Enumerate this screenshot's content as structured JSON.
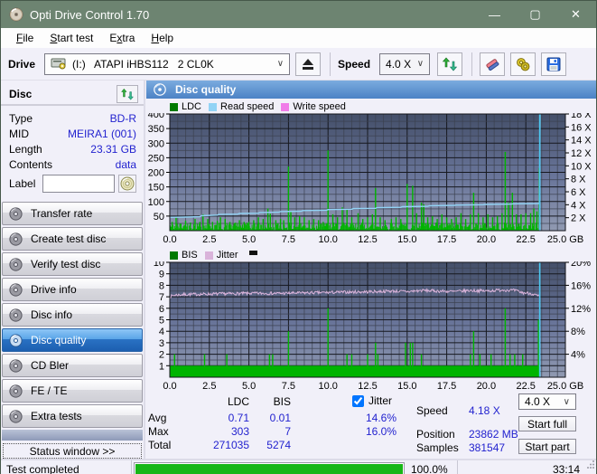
{
  "window": {
    "title": "Opti Drive Control 1.70",
    "controls": {
      "minimize": "—",
      "maximize": "▢",
      "close": "✕"
    }
  },
  "menu": {
    "items": [
      {
        "label": "File",
        "accel": 0
      },
      {
        "label": "Start test",
        "accel": 0
      },
      {
        "label": "Extra",
        "accel": 1
      },
      {
        "label": "Help",
        "accel": 0
      }
    ]
  },
  "toolbar": {
    "drive_label": "Drive",
    "drive_value": "(I:)   ATAPI iHBS112   2 CL0K",
    "speed_label": "Speed",
    "speed_value": "4.0 X"
  },
  "sidebar": {
    "disc_header": "Disc",
    "info": [
      {
        "label": "Type",
        "value": "BD-R"
      },
      {
        "label": "MID",
        "value": "MEIRA1 (001)"
      },
      {
        "label": "Length",
        "value": "23.31 GB"
      },
      {
        "label": "Contents",
        "value": "data"
      }
    ],
    "label_field": {
      "label": "Label",
      "value": ""
    },
    "buttons": [
      {
        "label": "Transfer rate"
      },
      {
        "label": "Create test disc"
      },
      {
        "label": "Verify test disc"
      },
      {
        "label": "Drive info"
      },
      {
        "label": "Disc info"
      },
      {
        "label": "Disc quality",
        "active": true
      },
      {
        "label": "CD Bler"
      },
      {
        "label": "FE / TE"
      },
      {
        "label": "Extra tests"
      }
    ],
    "status_window": "Status window >>"
  },
  "panel": {
    "title": "Disc quality"
  },
  "results": {
    "col_ldc": "LDC",
    "col_bis": "BIS",
    "jitter_label": "Jitter",
    "jitter_checked": true,
    "rows": {
      "avg_label": "Avg",
      "avg_ldc": "0.71",
      "avg_bis": "0.01",
      "avg_jitter": "14.6%",
      "max_label": "Max",
      "max_ldc": "303",
      "max_bis": "7",
      "max_jitter": "16.0%",
      "total_label": "Total",
      "total_ldc": "271035",
      "total_bis": "5274"
    },
    "speed_label": "Speed",
    "speed_value": "4.18 X",
    "position_label": "Position",
    "position_value": "23862 MB",
    "samples_label": "Samples",
    "samples_value": "381547",
    "speed_select": "4.0 X",
    "start_full": "Start full",
    "start_part": "Start part"
  },
  "statusbar": {
    "text": "Test completed",
    "progress": "100.0%",
    "progress_value": 100,
    "time": "33:14"
  },
  "colors": {
    "accent_blue": "#2222cf",
    "ldc_green": "#00b400",
    "read_blue": "#92d3f5",
    "write_pink": "#f07ce8",
    "jitter_pink": "#d9b3da",
    "cursor_cyan": "#4cc8f0",
    "progress_green": "#17b617",
    "titlebar_green": "#6d8471"
  },
  "chart_data": [
    {
      "type": "spikes+line",
      "title": "Disc quality (LDC / Read speed)",
      "xmax": 25,
      "data_end": 23.38,
      "x_tick_step": 2.5,
      "x_unit": "GB",
      "left_axis": {
        "max": 400,
        "ticks": [
          400,
          350,
          300,
          250,
          200,
          150,
          100,
          50
        ]
      },
      "right_axis": {
        "max": 18,
        "ticks": [
          18,
          16,
          14,
          12,
          10,
          8,
          6,
          4,
          2
        ],
        "suffix": " X"
      },
      "grid": {
        "minor_x": 0.5,
        "major_x": 2.5,
        "minor_y": 25,
        "major_y": 50
      },
      "cursor": {
        "x": 23.38,
        "color": "#4cc8f0"
      },
      "series": [
        {
          "name": "LDC",
          "type": "spikes",
          "color": "#00b400",
          "legend_color": "#007a00",
          "scale": "left",
          "baseline_noise": {
            "max": 26,
            "step": 0.055,
            "seed": 42
          },
          "spikes": [
            [
              0.15,
              30
            ],
            [
              0.4,
              46
            ],
            [
              0.7,
              24
            ],
            [
              1.0,
              34
            ],
            [
              1.3,
              28
            ],
            [
              1.6,
              40
            ],
            [
              1.9,
              30
            ],
            [
              2.1,
              56
            ],
            [
              2.4,
              40
            ],
            [
              2.7,
              30
            ],
            [
              3.0,
              34
            ],
            [
              3.2,
              46
            ],
            [
              3.5,
              40
            ],
            [
              3.8,
              30
            ],
            [
              4.1,
              26
            ],
            [
              4.4,
              36
            ],
            [
              4.7,
              30
            ],
            [
              5.0,
              30
            ],
            [
              5.3,
              36
            ],
            [
              5.6,
              46
            ],
            [
              5.9,
              40
            ],
            [
              6.2,
              76
            ],
            [
              6.35,
              58
            ],
            [
              6.7,
              36
            ],
            [
              7.0,
              40
            ],
            [
              7.2,
              36
            ],
            [
              7.5,
              220
            ],
            [
              7.65,
              66
            ],
            [
              7.9,
              46
            ],
            [
              8.2,
              50
            ],
            [
              8.5,
              46
            ],
            [
              8.8,
              36
            ],
            [
              9.1,
              40
            ],
            [
              9.4,
              36
            ],
            [
              9.7,
              30
            ],
            [
              10.0,
              275
            ],
            [
              10.3,
              56
            ],
            [
              10.6,
              46
            ],
            [
              10.9,
              80
            ],
            [
              11.2,
              74
            ],
            [
              11.5,
              46
            ],
            [
              11.9,
              60
            ],
            [
              12.2,
              40
            ],
            [
              12.5,
              46
            ],
            [
              12.8,
              56
            ],
            [
              13.0,
              146
            ],
            [
              13.3,
              46
            ],
            [
              13.6,
              36
            ],
            [
              14.0,
              40
            ],
            [
              14.3,
              46
            ],
            [
              14.6,
              40
            ],
            [
              15.0,
              160
            ],
            [
              15.35,
              154
            ],
            [
              15.6,
              60
            ],
            [
              15.9,
              96
            ],
            [
              16.05,
              90
            ],
            [
              16.3,
              46
            ],
            [
              16.6,
              50
            ],
            [
              16.9,
              40
            ],
            [
              17.2,
              56
            ],
            [
              17.5,
              46
            ],
            [
              17.8,
              40
            ],
            [
              18.1,
              46
            ],
            [
              18.4,
              60
            ],
            [
              18.7,
              40
            ],
            [
              19.0,
              56
            ],
            [
              19.2,
              130
            ],
            [
              19.5,
              60
            ],
            [
              19.8,
              46
            ],
            [
              20.1,
              56
            ],
            [
              20.4,
              46
            ],
            [
              20.7,
              50
            ],
            [
              21.0,
              60
            ],
            [
              21.2,
              270
            ],
            [
              21.4,
              96
            ],
            [
              21.65,
              130
            ],
            [
              21.9,
              56
            ],
            [
              22.2,
              56
            ],
            [
              22.5,
              60
            ],
            [
              22.8,
              60
            ],
            [
              23.0,
              76
            ],
            [
              23.2,
              66
            ],
            [
              23.35,
              215
            ]
          ]
        },
        {
          "name": "Read speed",
          "type": "line",
          "color": "#92d3f5",
          "scale": "right",
          "points": [
            [
              0,
              2.05
            ],
            [
              1,
              2.1
            ],
            [
              1.9,
              2.15
            ],
            [
              2.0,
              2.3
            ],
            [
              3.0,
              2.4
            ],
            [
              3.1,
              2.5
            ],
            [
              4.3,
              2.55
            ],
            [
              4.4,
              2.65
            ],
            [
              5.6,
              2.7
            ],
            [
              5.7,
              2.8
            ],
            [
              6.9,
              2.85
            ],
            [
              7.0,
              2.95
            ],
            [
              8.3,
              3.0
            ],
            [
              8.4,
              3.1
            ],
            [
              9.9,
              3.15
            ],
            [
              10.0,
              3.25
            ],
            [
              11.5,
              3.3
            ],
            [
              11.6,
              3.4
            ],
            [
              13.0,
              3.45
            ],
            [
              13.1,
              3.55
            ],
            [
              14.6,
              3.6
            ],
            [
              14.7,
              3.7
            ],
            [
              16.3,
              3.75
            ],
            [
              16.4,
              3.85
            ],
            [
              18.0,
              3.9
            ],
            [
              18.1,
              3.95
            ],
            [
              19.8,
              4.0
            ],
            [
              19.9,
              4.05
            ],
            [
              21.6,
              4.1
            ],
            [
              21.7,
              4.15
            ],
            [
              23.3,
              4.18
            ],
            [
              23.36,
              4.2
            ],
            [
              23.4,
              18
            ]
          ]
        },
        {
          "name": "Write speed",
          "type": "line",
          "color": "#f07ce8",
          "scale": "right",
          "points": []
        }
      ]
    },
    {
      "type": "spikes+line",
      "title": "Disc quality (BIS / Jitter)",
      "xmax": 25,
      "data_end": 23.38,
      "x_tick_step": 2.5,
      "x_unit": "GB",
      "left_axis": {
        "max": 10,
        "ticks": [
          10,
          9,
          8,
          7,
          6,
          5,
          4,
          3,
          2,
          1
        ]
      },
      "right_axis": {
        "max": 20,
        "ticks": [
          20,
          16,
          12,
          8,
          4
        ],
        "suffix": "%"
      },
      "grid": {
        "minor_x": 0.5,
        "major_x": 2.5,
        "minor_y": 0.5,
        "major_y": 1
      },
      "cursor": {
        "x": 23.38,
        "color": "#4cc8f0"
      },
      "series": [
        {
          "name": "BIS",
          "type": "spikes",
          "color": "#00b400",
          "legend_color": "#007a00",
          "scale": "left",
          "band": 1,
          "spikes": [
            [
              0.3,
              2
            ],
            [
              2.2,
              2
            ],
            [
              3.6,
              2
            ],
            [
              6.3,
              2
            ],
            [
              6.5,
              2
            ],
            [
              7.5,
              4
            ],
            [
              10.0,
              6
            ],
            [
              11.2,
              2
            ],
            [
              11.5,
              2
            ],
            [
              12.5,
              2
            ],
            [
              13.0,
              3
            ],
            [
              13.15,
              2
            ],
            [
              14.9,
              3
            ],
            [
              15.2,
              3
            ],
            [
              15.35,
              3
            ],
            [
              15.9,
              2
            ],
            [
              19.0,
              2
            ],
            [
              19.2,
              4
            ],
            [
              19.6,
              2
            ],
            [
              20.3,
              2
            ],
            [
              21.2,
              6
            ],
            [
              21.5,
              2
            ],
            [
              21.8,
              2
            ],
            [
              22.3,
              2
            ],
            [
              23.3,
              5
            ]
          ]
        },
        {
          "name": "Jitter",
          "type": "noisy-line",
          "color": "#d9b3da",
          "scale": "left",
          "noise": 0.13,
          "noise_step": 0.045,
          "seed": 7,
          "points": [
            [
              0,
              7.0
            ],
            [
              0.3,
              7.15
            ],
            [
              1,
              7.2
            ],
            [
              3,
              7.25
            ],
            [
              5,
              7.3
            ],
            [
              7,
              7.3
            ],
            [
              9,
              7.35
            ],
            [
              11,
              7.4
            ],
            [
              13,
              7.45
            ],
            [
              14,
              7.5
            ],
            [
              15,
              7.45
            ],
            [
              16,
              7.55
            ],
            [
              17,
              7.5
            ],
            [
              18,
              7.45
            ],
            [
              19,
              7.55
            ],
            [
              20,
              7.5
            ],
            [
              21,
              7.6
            ],
            [
              21.8,
              7.55
            ],
            [
              22.3,
              7.35
            ],
            [
              22.8,
              7.3
            ],
            [
              23.2,
              7.1
            ],
            [
              23.38,
              7.0
            ]
          ]
        }
      ]
    }
  ]
}
